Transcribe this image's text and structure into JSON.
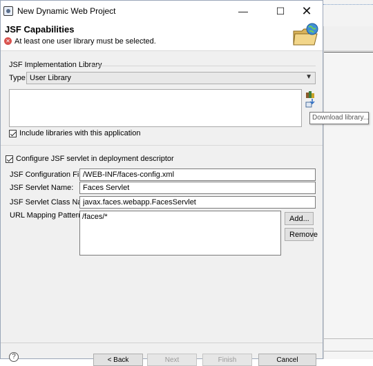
{
  "window": {
    "title": "New Dynamic Web Project",
    "minimize_glyph": "—",
    "maximize_glyph": "☐",
    "close_glyph": "✕"
  },
  "header": {
    "title": "JSF Capabilities",
    "message": "At least one user library must be selected.",
    "error_icon": "error-icon",
    "wizard_graphic": "folder-globe-icon"
  },
  "implementation": {
    "group_label": "JSF Implementation Library",
    "type_label": "Type:",
    "type_value": "User Library",
    "tooltip": "Download library...",
    "include_label": "Include libraries with this application",
    "include_checked": true
  },
  "configure": {
    "label": "Configure JSF servlet in deployment descriptor",
    "checked": true
  },
  "form": {
    "config_file_label": "JSF Configuration File:",
    "config_file_value": "/WEB-INF/faces-config.xml",
    "servlet_name_label": "JSF Servlet Name:",
    "servlet_name_value": "Faces Servlet",
    "servlet_class_label": "JSF Servlet Class Name:",
    "servlet_class_value": "javax.faces.webapp.FacesServlet",
    "url_mapping_label": "URL Mapping Patterns:",
    "url_patterns": [
      "/faces/*"
    ],
    "add_label": "Add...",
    "remove_label": "Remove"
  },
  "footer": {
    "help_glyph": "?",
    "back_label": "< Back",
    "next_label": "Next",
    "finish_label": "Finish",
    "cancel_label": "Cancel"
  },
  "colors": {
    "error": "#d9534f",
    "dialog_bg": "#f0f0f0",
    "button_bg": "#e1e1e1"
  }
}
